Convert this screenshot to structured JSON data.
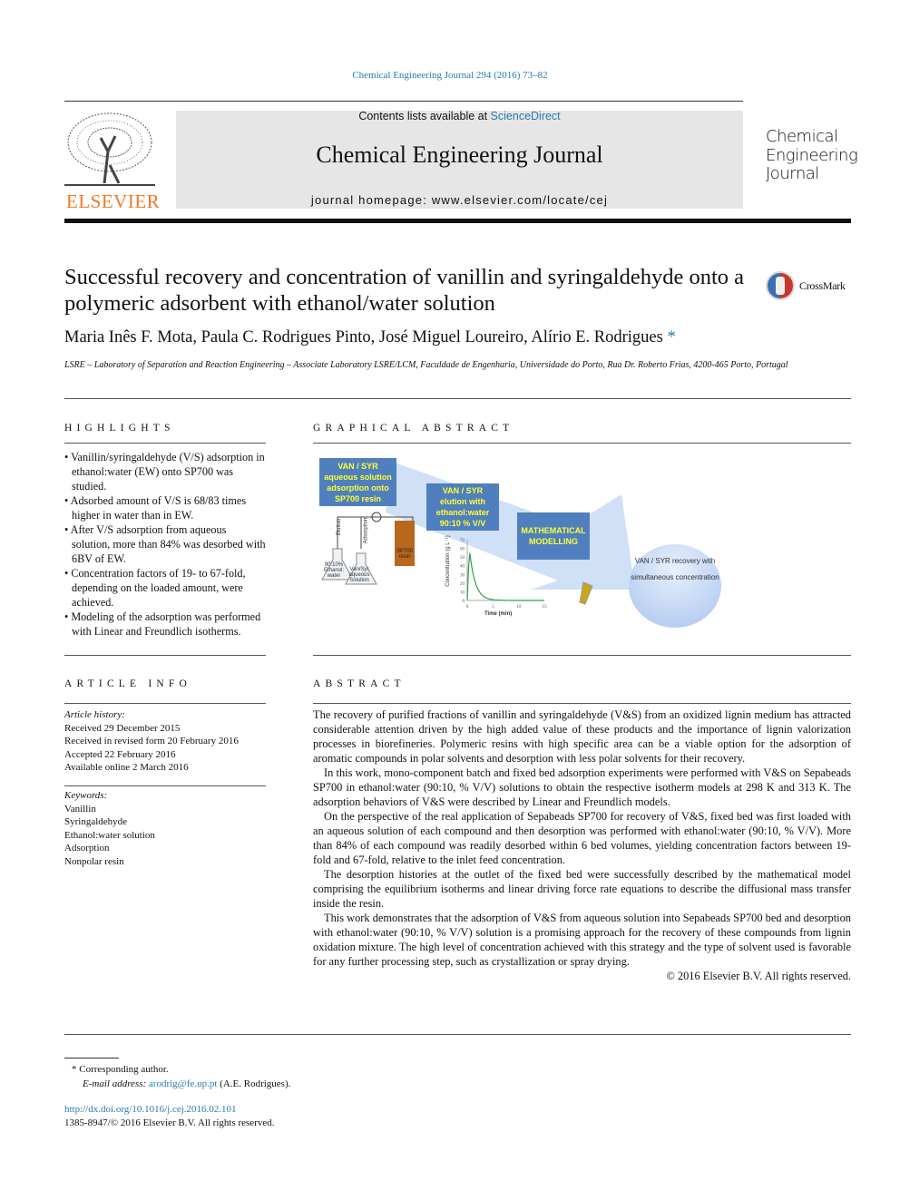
{
  "header": {
    "citation": "Chemical Engineering Journal 294 (2016) 73–82",
    "contents_prefix": "Contents lists available at ",
    "contents_link": "ScienceDirect",
    "journal_title": "Chemical Engineering Journal",
    "homepage": "journal homepage: www.elsevier.com/locate/cej",
    "publisher": "ELSEVIER",
    "cover_lines": [
      "Chemical",
      "Engineering",
      "Journal"
    ],
    "crossmark": "CrossMark"
  },
  "article": {
    "title": "Successful recovery and concentration of vanillin and syringaldehyde onto a polymeric adsorbent with ethanol/water solution",
    "authors": "Maria Inês F. Mota, Paula C. Rodrigues Pinto, José Miguel Loureiro, Alírio E. Rodrigues",
    "author_mark": "*",
    "affiliation": "LSRE – Laboratory of Separation and Reaction Engineering – Associate Laboratory LSRE/LCM, Faculdade de Engenharia, Universidade do Porto, Rua Dr. Roberto Frias, 4200-465 Porto, Portugal"
  },
  "highlights": {
    "heading": "HIGHLIGHTS",
    "items": [
      "Vanillin/syringaldehyde (V/S) adsorption in ethanol:water (EW) onto SP700 was studied.",
      "Adsorbed amount of V/S is 68/83 times higher in water than in EW.",
      "After V/S adsorption from aqueous solution, more than 84% was desorbed with 6BV of EW.",
      "Concentration factors of 19- to 67-fold, depending on the loaded amount, were achieved.",
      "Modeling of the adsorption was performed with Linear and Freundlich isotherms."
    ]
  },
  "graphical_abstract": {
    "heading": "GRAPHICAL ABSTRACT",
    "box1": "VAN / SYR aqueous solution adsorption onto SP700 resin",
    "box2": "VAN / SYR elution with ethanol:water 90:10 % V/V",
    "box3": "MATHEMATICAL MODELLING",
    "circle": "VAN / SYR recovery with simultaneous concentration",
    "flask1": "90:10% Ethanol: water",
    "flask2": "Van/Syr aqueous Solution",
    "tube1": "Elution",
    "tube2": "Adsorption",
    "column": "SP700 resin",
    "chart": {
      "ylabel": "Concentration (g L⁻¹)",
      "xlabel": "Time (min)",
      "yticks": [
        "0",
        "10",
        "20",
        "30",
        "40",
        "50",
        "60",
        "70"
      ],
      "xticks": [
        "0",
        "5",
        "10",
        "15"
      ]
    }
  },
  "article_info": {
    "heading": "ARTICLE INFO",
    "history_label": "Article history:",
    "history": [
      "Received 29 December 2015",
      "Received in revised form 20 February 2016",
      "Accepted 22 February 2016",
      "Available online 2 March 2016"
    ],
    "keywords_label": "Keywords:",
    "keywords": [
      "Vanillin",
      "Syringaldehyde",
      "Ethanol:water solution",
      "Adsorption",
      "Nonpolar resin"
    ]
  },
  "abstract": {
    "heading": "ABSTRACT",
    "paragraphs": [
      "The recovery of purified fractions of vanillin and syringaldehyde (V&S) from an oxidized lignin medium has attracted considerable attention driven by the high added value of these products and the importance of lignin valorization processes in biorefineries. Polymeric resins with high specific area can be a viable option for the adsorption of aromatic compounds in polar solvents and desorption with less polar solvents for their recovery.",
      "In this work, mono-component batch and fixed bed adsorption experiments were performed with V&S on Sepabeads SP700 in ethanol:water (90:10, % V/V) solutions to obtain the respective isotherm models at 298 K and 313 K. The adsorption behaviors of V&S were described by Linear and Freundlich models.",
      "On the perspective of the real application of Sepabeads SP700 for recovery of V&S, fixed bed was first loaded with an aqueous solution of each compound and then desorption was performed with ethanol:water (90:10, % V/V). More than 84% of each compound was readily desorbed within 6 bed volumes, yielding concentration factors between 19-fold and 67-fold, relative to the inlet feed concentration.",
      "The desorption histories at the outlet of the fixed bed were successfully described by the mathematical model comprising the equilibrium isotherms and linear driving force rate equations to describe the diffusional mass transfer inside the resin.",
      "This work demonstrates that the adsorption of V&S from aqueous solution into Sepabeads SP700 bed and desorption with ethanol:water (90:10, % V/V) solution is a promising approach for the recovery of these compounds from lignin oxidation mixture. The high level of concentration achieved with this strategy and the type of solvent used is favorable for any further processing step, such as crystallization or spray drying."
    ],
    "copyright": "© 2016 Elsevier B.V. All rights reserved."
  },
  "footnote": {
    "mark": "*",
    "corresponding": "Corresponding author.",
    "email_label": "E-mail address:",
    "email": "arodrig@fe.up.pt",
    "email_suffix": "(A.E. Rodrigues).",
    "doi": "http://dx.doi.org/10.1016/j.cej.2016.02.101",
    "issn": "1385-8947/© 2016 Elsevier B.V. All rights reserved."
  },
  "colors": {
    "link": "#2a7ab0",
    "elsevier": "#f07a22",
    "ga_box": "#4f7fbf",
    "ga_text": "#ffff33"
  }
}
